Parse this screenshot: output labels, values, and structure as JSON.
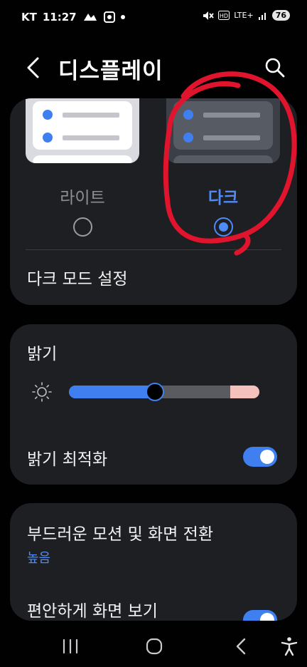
{
  "status_bar": {
    "carrier": "KT",
    "time": "11:27",
    "network": "LTE+",
    "battery": "76"
  },
  "header": {
    "title": "디스플레이"
  },
  "theme": {
    "light_label": "라이트",
    "dark_label": "다크",
    "selected": "dark",
    "dark_mode_settings_label": "다크 모드 설정"
  },
  "brightness": {
    "label": "밝기",
    "level": 0.45,
    "adaptive_label": "밝기 최적화",
    "adaptive_enabled": true
  },
  "motion": {
    "label": "부드러운 모션 및 화면 전환",
    "value": "높음",
    "eye_comfort_label": "편안하게 화면 보기",
    "eye_comfort_enabled": true
  },
  "colors": {
    "accent": "#3f7ff0",
    "card": "#1e1f23",
    "annotation": "#e0142c"
  },
  "navbar": {
    "icons": [
      "recent-apps-icon",
      "home-icon",
      "back-icon",
      "accessibility-icon"
    ]
  }
}
